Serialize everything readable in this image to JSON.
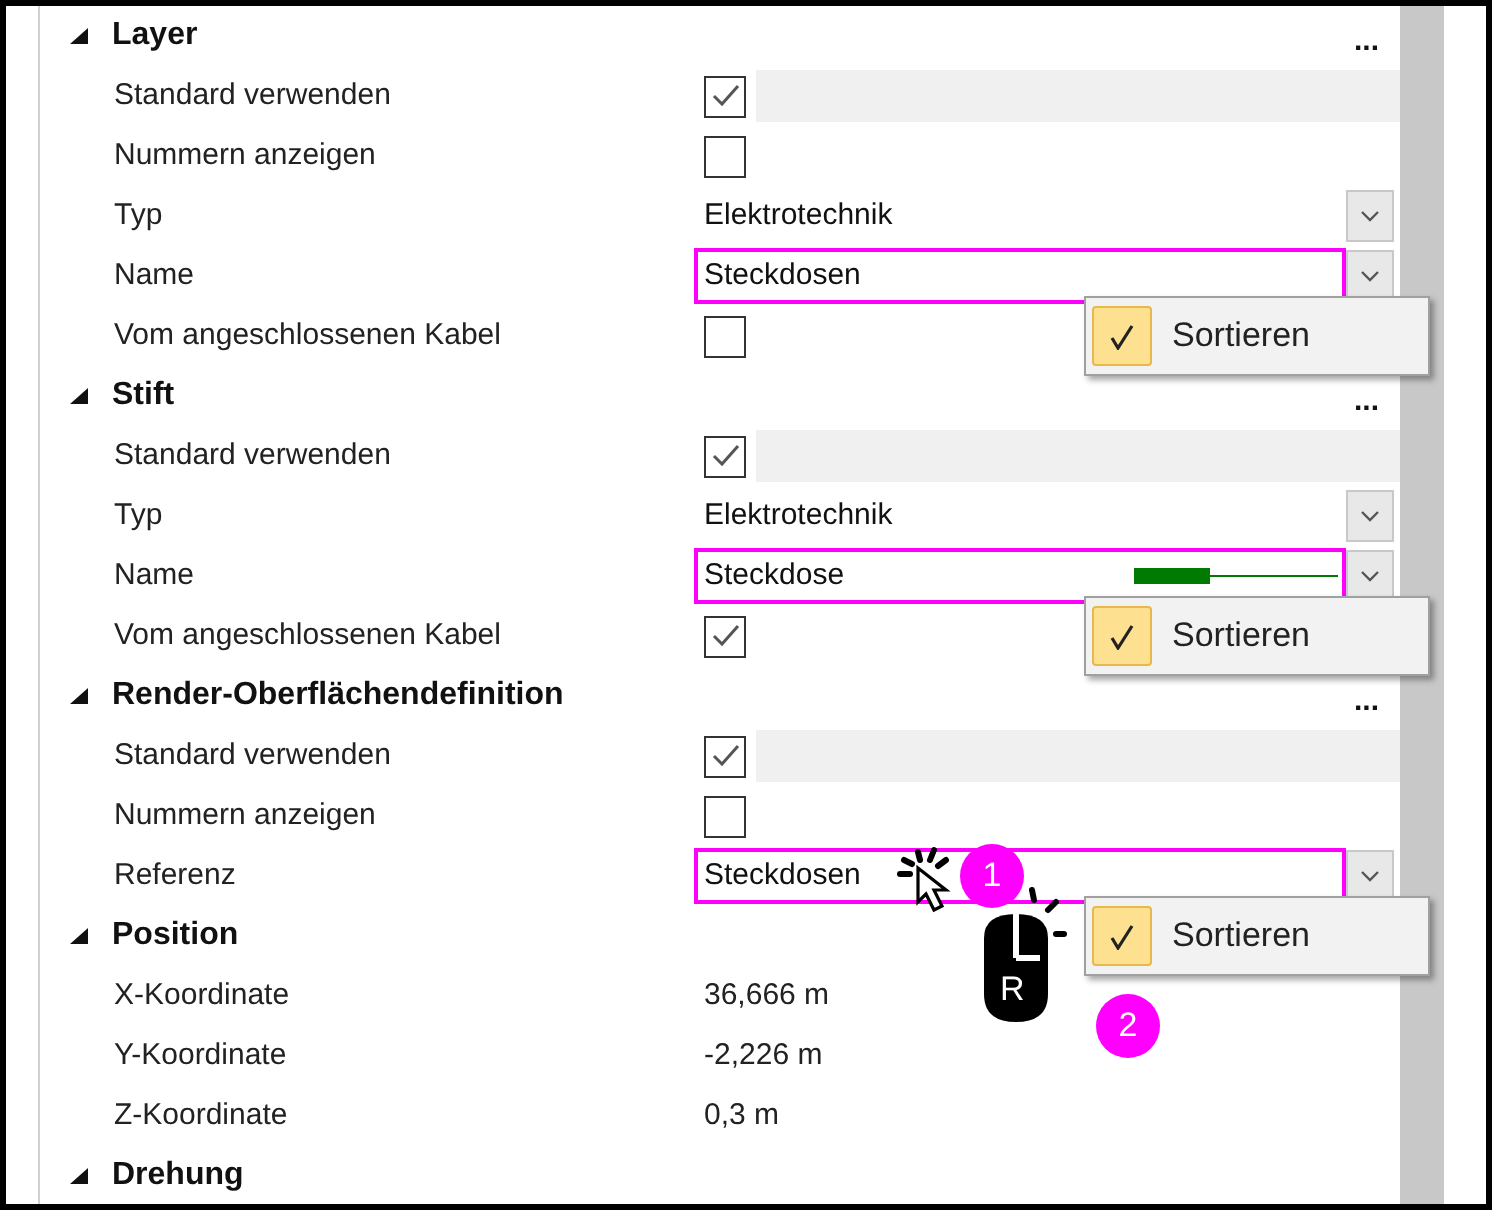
{
  "sections": [
    {
      "title": "Layer",
      "expanded": true,
      "ellipsis": "...",
      "rows": [
        {
          "kind": "checkbox",
          "label": "Standard verwenden",
          "checked": true,
          "filler": true
        },
        {
          "kind": "checkbox",
          "label": "Nummern anzeigen",
          "checked": false
        },
        {
          "kind": "dropdown",
          "label": "Typ",
          "value": "Elektrotechnik",
          "highlighted": false
        },
        {
          "kind": "dropdown",
          "label": "Name",
          "value": "Steckdosen",
          "highlighted": true,
          "menu": {
            "label": "Sortieren",
            "checked": true
          }
        },
        {
          "kind": "checkbox",
          "label": "Vom angeschlossenen Kabel",
          "checked": false
        }
      ]
    },
    {
      "title": "Stift",
      "expanded": true,
      "ellipsis": "...",
      "rows": [
        {
          "kind": "checkbox",
          "label": "Standard verwenden",
          "checked": true,
          "filler": true
        },
        {
          "kind": "dropdown",
          "label": "Typ",
          "value": "Elektrotechnik",
          "highlighted": false
        },
        {
          "kind": "pen",
          "label": "Name",
          "value": "Steckdose",
          "highlighted": true,
          "menu": {
            "label": "Sortieren",
            "checked": true
          }
        },
        {
          "kind": "checkbox",
          "label": "Vom angeschlossenen Kabel",
          "checked": true
        }
      ]
    },
    {
      "title": "Render-Oberflächendefinition",
      "expanded": true,
      "ellipsis": "...",
      "rows": [
        {
          "kind": "checkbox",
          "label": "Standard verwenden",
          "checked": true,
          "filler": true
        },
        {
          "kind": "checkbox",
          "label": "Nummern anzeigen",
          "checked": false
        },
        {
          "kind": "dropdown",
          "label": "Referenz",
          "value": "Steckdosen",
          "highlighted": true,
          "menu": {
            "label": "Sortieren",
            "checked": true
          },
          "annotations": [
            "1",
            "2"
          ],
          "mouse_label": "R"
        }
      ]
    },
    {
      "title": "Position",
      "expanded": true,
      "rows": [
        {
          "kind": "text",
          "label": "X-Koordinate",
          "value": "36,666 m"
        },
        {
          "kind": "text",
          "label": "Y-Koordinate",
          "value": "-2,226 m"
        },
        {
          "kind": "text",
          "label": "Z-Koordinate",
          "value": "0,3 m"
        }
      ]
    },
    {
      "title": "Drehung",
      "expanded": true
    }
  ]
}
